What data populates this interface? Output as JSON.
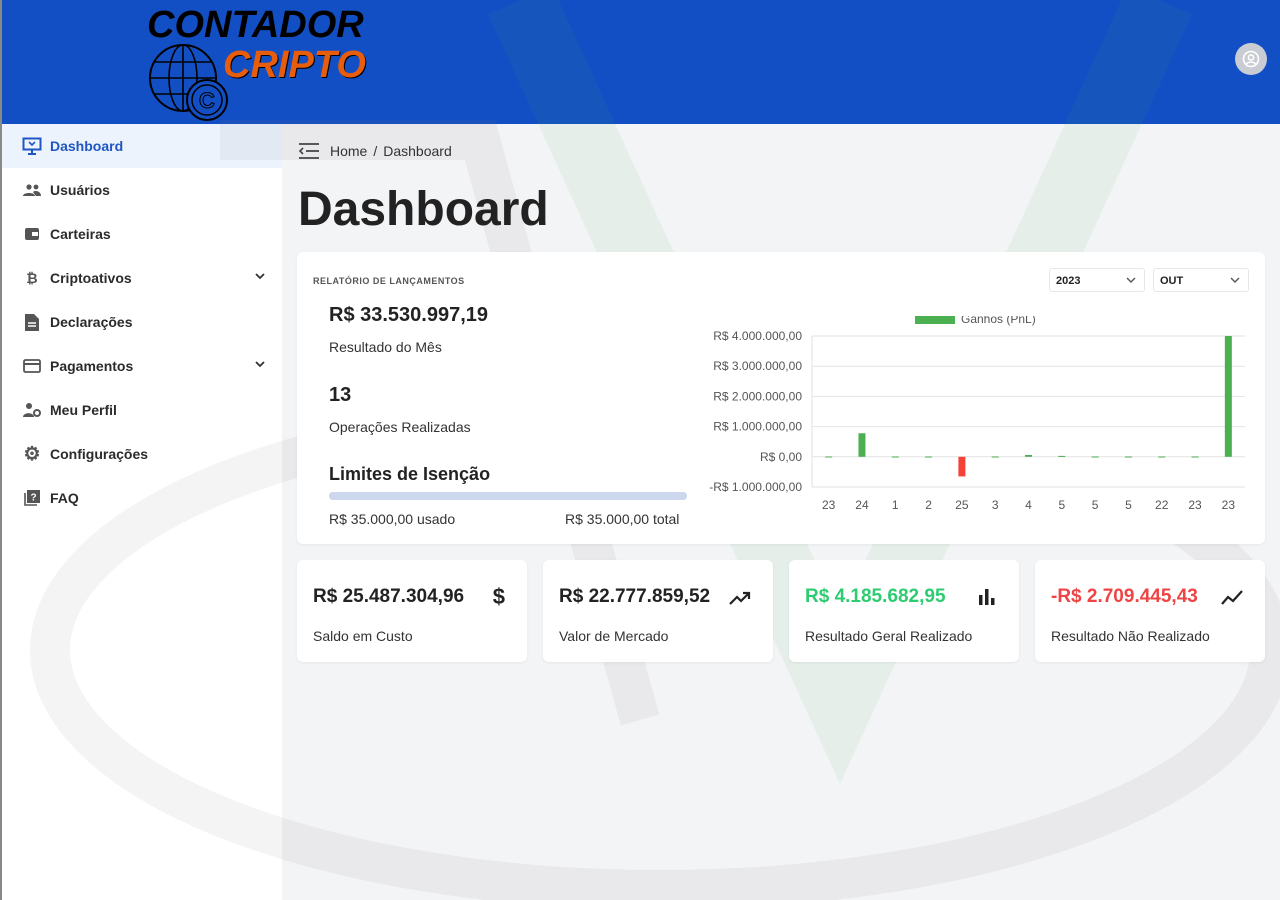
{
  "header": {
    "logo_line1": "CONTADOR",
    "logo_line2": "CRIPTO",
    "avatar_icon": "user-circle-icon"
  },
  "sidebar": {
    "items": [
      {
        "label": "Dashboard",
        "icon": "monitor-icon",
        "active": true
      },
      {
        "label": "Usuários",
        "icon": "users-icon"
      },
      {
        "label": "Carteiras",
        "icon": "wallet-icon"
      },
      {
        "label": "Criptoativos",
        "icon": "bitcoin-icon",
        "expandable": true
      },
      {
        "label": "Declarações",
        "icon": "document-icon"
      },
      {
        "label": "Pagamentos",
        "icon": "credit-card-icon",
        "expandable": true
      },
      {
        "label": "Meu Perfil",
        "icon": "user-gear-icon"
      },
      {
        "label": "Configurações",
        "icon": "gear-icon"
      },
      {
        "label": "FAQ",
        "icon": "help-icon"
      }
    ]
  },
  "breadcrumb": {
    "home": "Home",
    "sep": "/",
    "current": "Dashboard"
  },
  "page_title": "Dashboard",
  "report": {
    "label": "RELATÓRIO DE LANÇAMENTOS",
    "month_result": "R$ 33.530.997,19",
    "month_result_label": "Resultado do Mês",
    "operations": "13",
    "operations_label": "Operações Realizadas",
    "limits_title": "Limites de Isenção",
    "used": "R$ 35.000,00 usado",
    "total": "R$ 35.000,00 total",
    "limit_progress_percent": 100,
    "year": "2023",
    "month": "OUT"
  },
  "chart_data": {
    "type": "bar",
    "legend": "Ganhos (PnL)",
    "legend_placement": "top",
    "categories": [
      "23",
      "24",
      "1",
      "2",
      "25",
      "3",
      "4",
      "5",
      "5",
      "5",
      "22",
      "23",
      "23"
    ],
    "values": [
      10000,
      780000,
      10000,
      10000,
      -650000,
      10000,
      60000,
      30000,
      10000,
      10000,
      10000,
      10000,
      4000000
    ],
    "ylim": [
      -1000000,
      4000000
    ],
    "yticks": [
      "R$ 4.000.000,00",
      "R$ 3.000.000,00",
      "R$ 2.000.000,00",
      "R$ 1.000.000,00",
      "R$ 0,00",
      "-R$ 1.000.000,00"
    ],
    "grid": true,
    "colors": {
      "positive": "#4caf50",
      "negative": "#f44336"
    }
  },
  "stats": [
    {
      "value": "R$ 25.487.304,96",
      "label": "Saldo em Custo",
      "icon": "dollar-icon",
      "color": "#222222"
    },
    {
      "value": "R$ 22.777.859,52",
      "label": "Valor de Mercado",
      "icon": "trending-up-icon",
      "color": "#222222"
    },
    {
      "value": "R$ 4.185.682,95",
      "label": "Resultado Geral Realizado",
      "icon": "bar-chart-icon",
      "color": "#2ecc71"
    },
    {
      "value": "-R$ 2.709.445,43",
      "label": "Resultado Não Realizado",
      "icon": "line-chart-icon",
      "color": "#ef4444"
    }
  ]
}
